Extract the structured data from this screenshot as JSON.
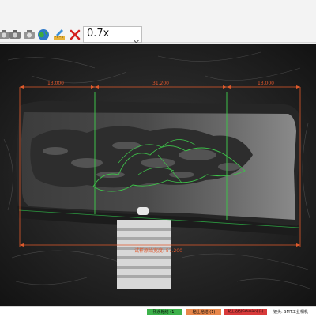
{
  "toolbar": {
    "buttons": [
      {
        "name": "camera-snapshot-icon"
      },
      {
        "name": "camera-record-icon"
      },
      {
        "name": "globe-icon"
      },
      {
        "name": "calibrate-ruler-icon"
      },
      {
        "name": "close-red-x-icon"
      }
    ],
    "zoom": {
      "value": "0.7x",
      "icon": "chevron-down-icon"
    }
  },
  "measurements": {
    "segment_left": "13.000",
    "segment_middle": "31.200",
    "segment_right": "13.000",
    "original_width": "试样原始宽度: 57.200"
  },
  "colors": {
    "dimension_line": "#e05a2b",
    "boundary_line": "#3ec14a",
    "inner_line": "#2ea944"
  },
  "status_legend": [
    {
      "label": "残余粘结 (1)",
      "color": "#3db24b"
    },
    {
      "label": "粘土粘结 (1)",
      "color": "#e8874a"
    },
    {
      "label": "粘土粘结(Cohesion) (1)",
      "color": "#d83a3a"
    },
    {
      "label": "镜头: SMT工业相机",
      "color": ""
    }
  ]
}
